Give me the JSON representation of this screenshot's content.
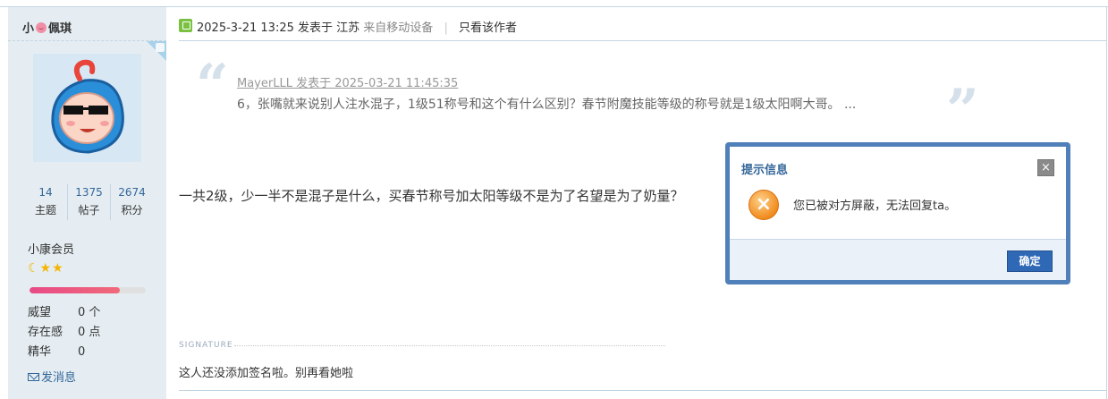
{
  "sidebar": {
    "username_prefix": "小",
    "username_suffix": "佩琪",
    "stats": [
      {
        "value": "14",
        "label": "主题"
      },
      {
        "value": "1375",
        "label": "帖子"
      },
      {
        "value": "2674",
        "label": "积分"
      }
    ],
    "rank": "小康会员",
    "stars": "☾★★",
    "credit_progress": 0.78,
    "attributes": [
      {
        "key": "威望",
        "value": "0 个"
      },
      {
        "key": "存在感",
        "value": "0 点"
      },
      {
        "key": "精华",
        "value": "0"
      }
    ],
    "send_message": "发消息"
  },
  "post": {
    "timestamp": "2025-3-21 13:25",
    "posted_in": "发表于 江苏",
    "device": "来自移动设备",
    "pipe": "|",
    "author_only": "只看该作者",
    "quote": {
      "meta": "MayerLLL 发表于 2025-03-21 11:45:35",
      "text": "6，张嘴就来说别人注水混子，1级51称号和这个有什么区别？春节附魔技能等级的称号就是1级太阳啊大哥。 ..."
    },
    "body": "一共2级，少一半不是混子是什么，买春节称号加太阳等级不是为了名望是为了奶量？",
    "signature_label": "SIGNATURE",
    "signature": "这人还没添加签名啦。别再看她啦"
  },
  "dialog": {
    "title": "提示信息",
    "close": "×",
    "icon": "error-icon",
    "message": "您已被对方屏蔽，无法回复ta。",
    "ok_label": "确定"
  },
  "colors": {
    "link_blue": "#336699",
    "sidebar_bg": "#e5edf2",
    "dialog_border": "#4f80b9",
    "button_blue": "#2f68b5"
  }
}
